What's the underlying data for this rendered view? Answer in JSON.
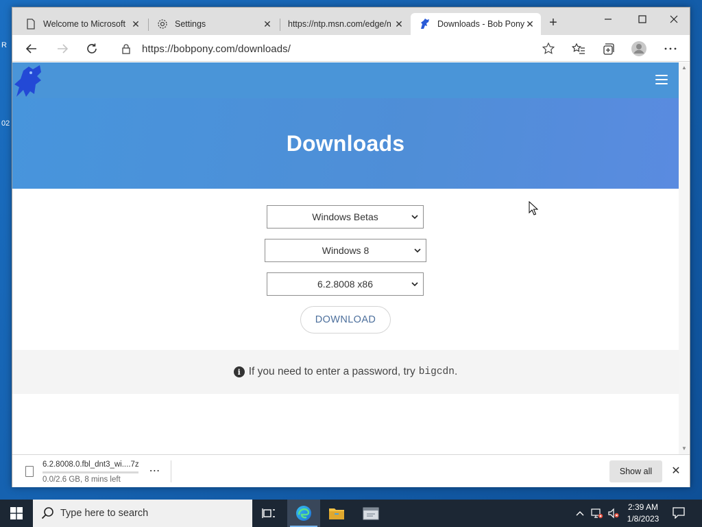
{
  "desktop": {
    "fragment_1": "R",
    "fragment_2": "02"
  },
  "browser": {
    "tabs": [
      {
        "label": "Welcome to Microsoft Edge",
        "icon": "page-icon"
      },
      {
        "label": "Settings",
        "icon": "gear-icon"
      },
      {
        "label": "https://ntp.msn.com/edge/ntp",
        "icon": "none"
      },
      {
        "label": "Downloads - Bob Pony",
        "icon": "bobpony-favicon",
        "active": true
      }
    ],
    "new_tab": "+",
    "address": {
      "url": "https://bobpony.com/downloads/"
    }
  },
  "page": {
    "title": "Downloads",
    "selects": {
      "category": "Windows Betas",
      "product": "Windows 8",
      "build": "6.2.8008 x86"
    },
    "download_button": "DOWNLOAD",
    "note": {
      "text": "If you need to enter a password, try",
      "code": "bigcdn",
      "suffix": "."
    },
    "colors": {
      "hero": "#4a95d8",
      "button_text": "#4c6f9c"
    }
  },
  "download_shelf": {
    "filename": "6.2.8008.0.fbl_dnt3_wi....7z",
    "status": "0.0/2.6 GB, 8 mins left",
    "progress_fraction": 0.0,
    "more": "⋯",
    "show_all": "Show all"
  },
  "taskbar": {
    "search_placeholder": "Type here to search",
    "time": "2:39 AM",
    "date": "1/8/2023"
  }
}
